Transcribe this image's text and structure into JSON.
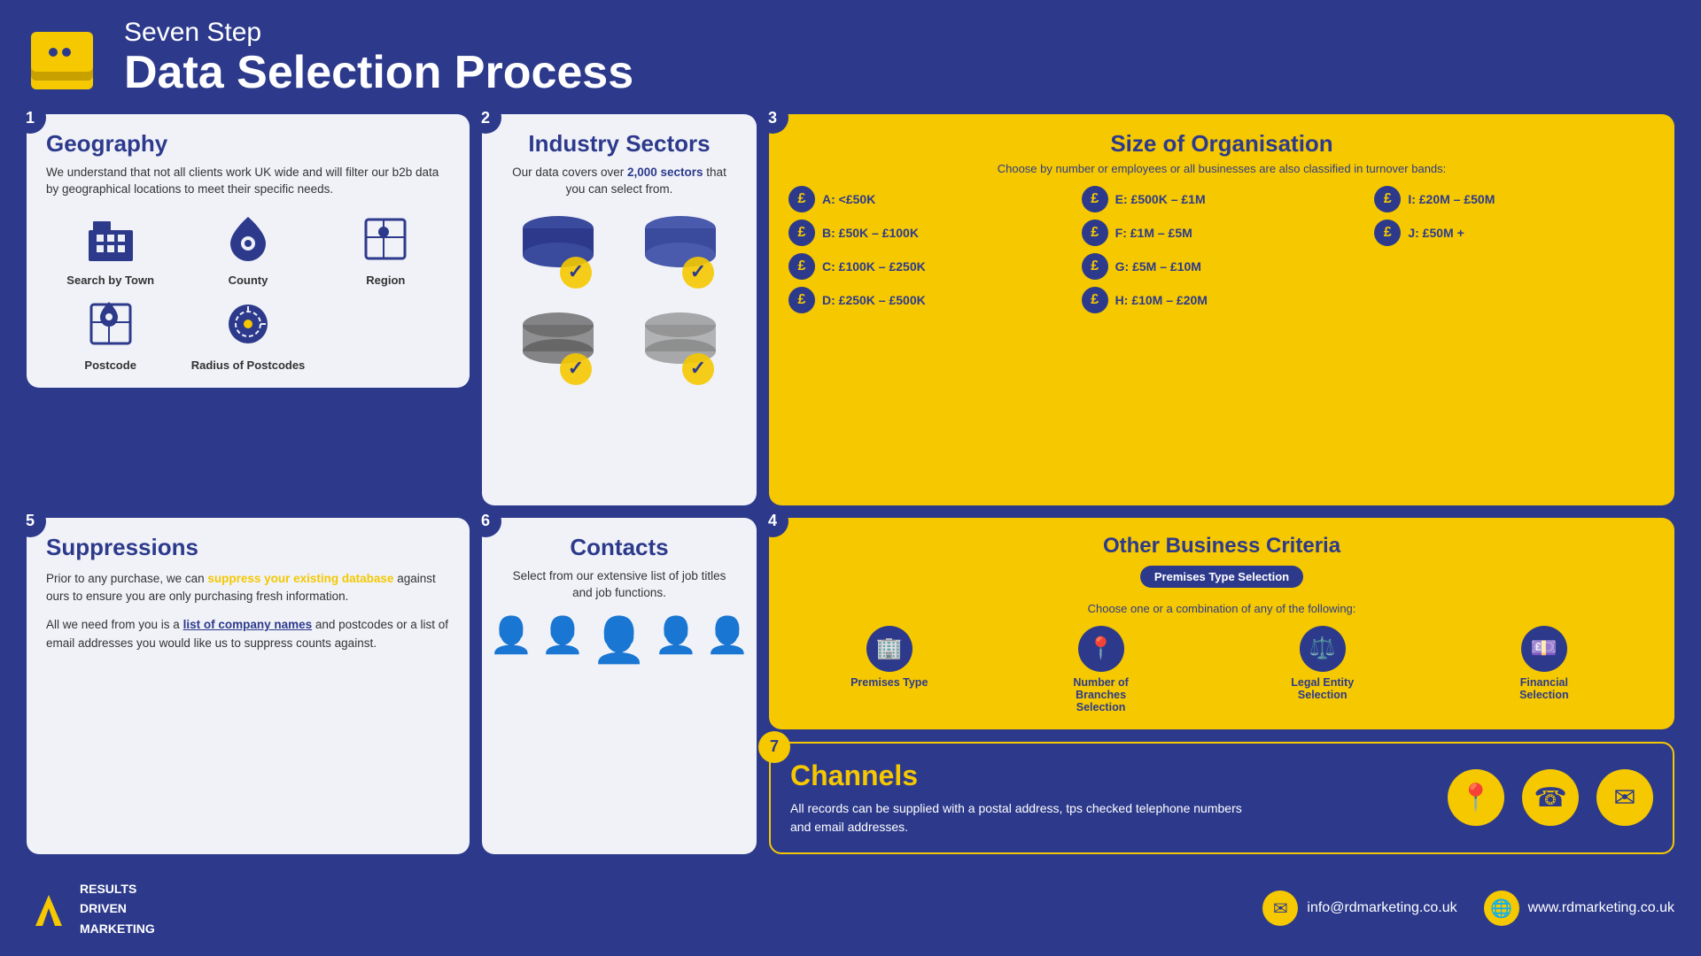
{
  "header": {
    "subtitle": "Seven Step",
    "title": "Data Selection Process"
  },
  "steps": {
    "step1": {
      "number": "1",
      "title": "Geography",
      "description": "We understand that not all clients work UK wide and will filter our b2b data by geographical locations to meet their specific needs.",
      "icons": [
        {
          "label": "Search by Town",
          "icon": "building"
        },
        {
          "label": "County",
          "icon": "map-pin"
        },
        {
          "label": "Region",
          "icon": "map-region"
        },
        {
          "label": "Postcode",
          "icon": "map-search"
        },
        {
          "label": "Radius of Postcodes",
          "icon": "radius"
        }
      ]
    },
    "step2": {
      "number": "2",
      "title": "Industry Sectors",
      "description_pre": "Our data covers over ",
      "highlight": "2,000 sectors",
      "description_post": " that you can select from."
    },
    "step3": {
      "number": "3",
      "title": "Size of Organisation",
      "subtitle": "Choose by number or employees or all businesses are also classified in turnover bands:",
      "bands": [
        {
          "label": "A: <£50K"
        },
        {
          "label": "E: £500K – £1M"
        },
        {
          "label": "I: £20M – £50M"
        },
        {
          "label": "B: £50K – £100K"
        },
        {
          "label": "F: £1M – £5M"
        },
        {
          "label": "J: £50M +"
        },
        {
          "label": "C: £100K – £250K"
        },
        {
          "label": "G: £5M – £10M"
        },
        {
          "label": ""
        },
        {
          "label": "D: £250K – £500K"
        },
        {
          "label": "H: £10M – £20M"
        },
        {
          "label": ""
        }
      ]
    },
    "step4": {
      "number": "4",
      "title": "Other Business Criteria",
      "badge": "Premises Type Selection",
      "choose_text": "Choose one or a combination of any of the following:",
      "criteria": [
        {
          "label": "Premises Type"
        },
        {
          "label": "Number of Branches Selection"
        },
        {
          "label": "Legal Entity Selection"
        },
        {
          "label": "Financial Selection"
        }
      ]
    },
    "step5": {
      "number": "5",
      "title": "Suppressions",
      "para1_pre": "Prior to any purchase, we can ",
      "para1_highlight": "suppress your existing database",
      "para1_post": " against ours to ensure you are only purchasing fresh information.",
      "para2_pre": "All we need from you is a ",
      "para2_highlight": "list of company names",
      "para2_post": " and postcodes or a list of email addresses you would like us to suppress counts against."
    },
    "step6": {
      "number": "6",
      "title": "Contacts",
      "description": "Select from our extensive list of job titles and job functions."
    },
    "step7": {
      "number": "7",
      "title": "Channels",
      "description": "All records can be supplied with a postal address, tps checked telephone numbers and email addresses."
    }
  },
  "footer": {
    "logo_line1": "RESULTS",
    "logo_line2": "DRIVEN",
    "logo_line3": "MARKETING",
    "email": "info@rdmarketing.co.uk",
    "website": "www.rdmarketing.co.uk"
  },
  "colors": {
    "navy": "#2d3a8c",
    "yellow": "#f5c800",
    "white": "#ffffff",
    "light_bg": "#eef0f8"
  }
}
